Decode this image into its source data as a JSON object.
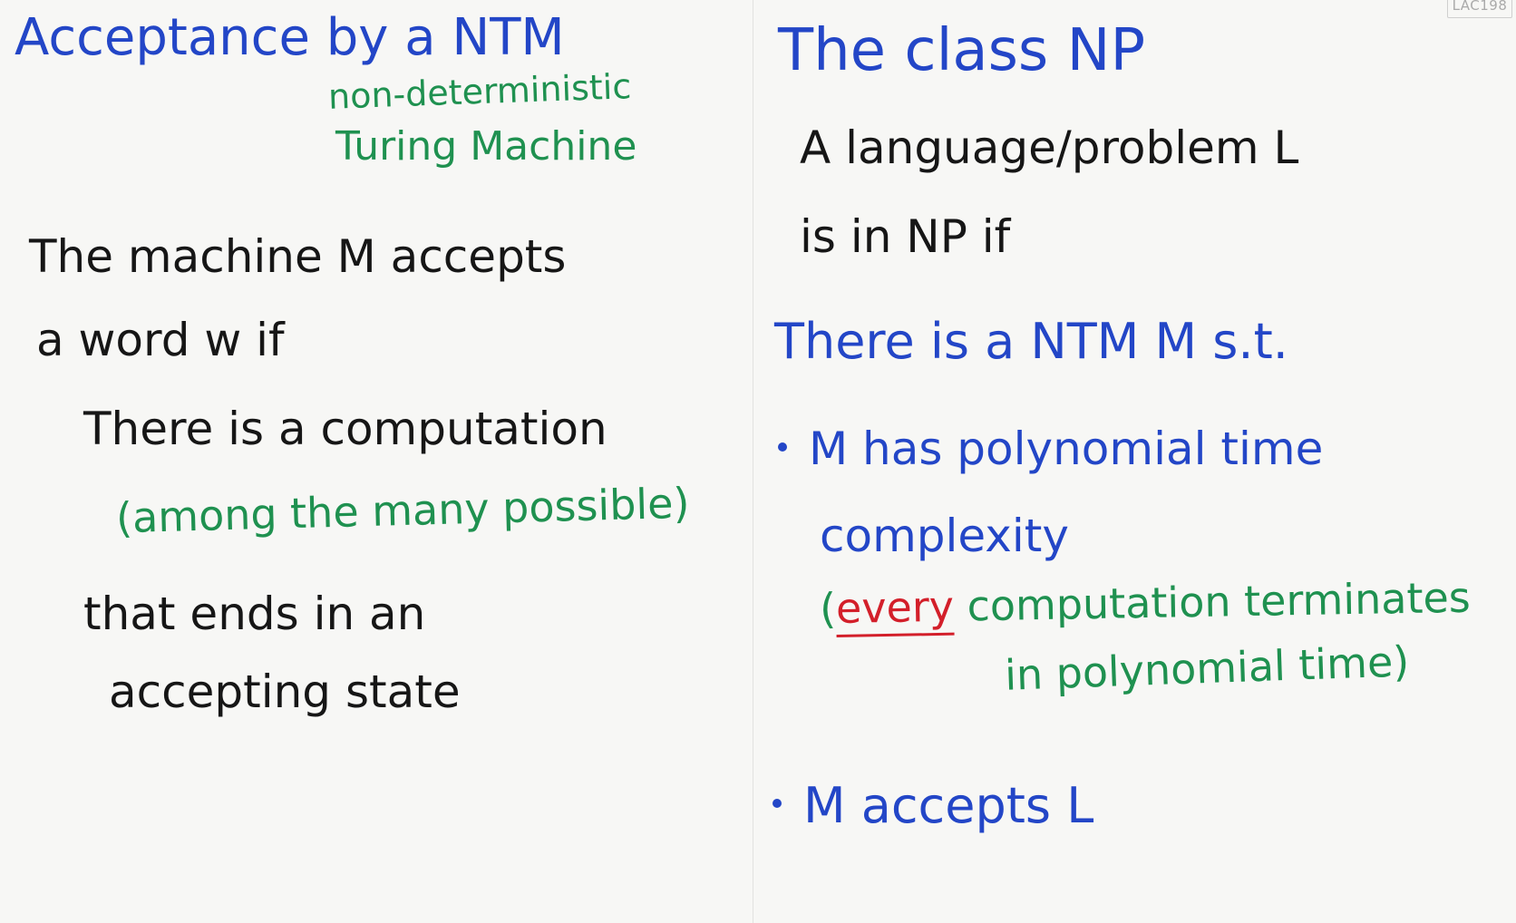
{
  "stamp": "LAC198",
  "left": {
    "title": "Acceptance by a NTM",
    "subtitle_line1": "non-deterministic",
    "subtitle_line2": "Turing  Machine",
    "line1": "The machine  M accepts",
    "line2": "a  word  w  if",
    "line3": "There  is  a  computation",
    "line4": "(among  the  many  possible)",
    "line5": "that  ends  in  an",
    "line6": "accepting  state"
  },
  "right": {
    "title": "The  class  NP",
    "line1": "A  language/problem  L",
    "line2": "is  in  NP  if",
    "line3": "There  is  a  NTM   M s.t.",
    "bullet1_line1": "M  has  polynomial  time",
    "bullet1_line2": "complexity",
    "paren_open": "(",
    "every": "every",
    "paren_rest": " computation terminates",
    "bullet1_line4": "in  polynomial  time)",
    "bullet2": "M  accepts  L"
  },
  "colors": {
    "blue": "#2346c7",
    "green": "#1f9150",
    "black": "#161616",
    "red": "#d31f2a"
  }
}
